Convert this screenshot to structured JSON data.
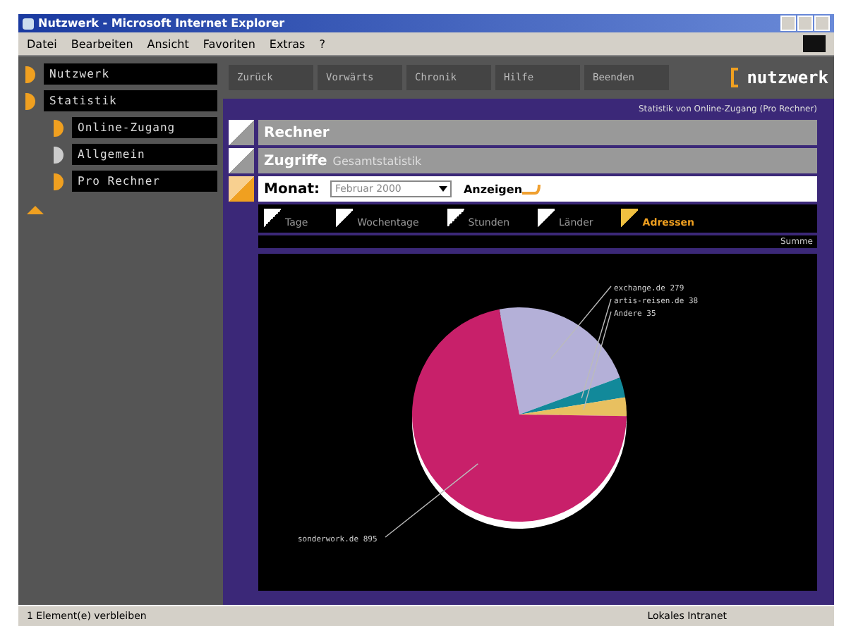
{
  "window": {
    "title": "Nutzwerk - Microsoft Internet Explorer"
  },
  "menu": [
    "Datei",
    "Bearbeiten",
    "Ansicht",
    "Favoriten",
    "Extras",
    "?"
  ],
  "sidebar": {
    "items": [
      {
        "label": "Nutzwerk",
        "selected": false
      },
      {
        "label": "Statistik",
        "selected": false,
        "children": [
          {
            "label": "Online-Zugang",
            "selected": false
          },
          {
            "label": "Allgemein",
            "selected": true
          },
          {
            "label": "Pro Rechner",
            "selected": false
          }
        ]
      }
    ]
  },
  "nav": {
    "buttons": [
      "Zurück",
      "Vorwärts",
      "Chronik",
      "Hilfe",
      "Beenden"
    ],
    "logo": "nutzwerk"
  },
  "page": {
    "subtitle": "Statistik von Online-Zugang (Pro Rechner)",
    "sections": [
      {
        "kind": "header",
        "label": "Rechner"
      },
      {
        "kind": "header",
        "label": "Zugriffe",
        "note": "Gesamtstatistik"
      },
      {
        "kind": "form",
        "label": "Monat:",
        "select": "Februar 2000",
        "button": "Anzeigen"
      }
    ],
    "tabs": [
      {
        "label": "Tage",
        "selected": false
      },
      {
        "label": "Wochentage",
        "selected": false
      },
      {
        "label": "Stunden",
        "selected": false
      },
      {
        "label": "Länder",
        "selected": false
      },
      {
        "label": "Adressen",
        "selected": true
      }
    ],
    "summary": "Summe",
    "chart": {
      "chart_data": {
        "type": "pie",
        "categories": [
          "exchange.de 279",
          "artis-reisen.de 38",
          "Andere 35",
          "sonderwork.de 895"
        ],
        "values": [
          279,
          38,
          35,
          895
        ]
      }
    }
  },
  "status_bar": {
    "text": "1 Element(e) verbleiben",
    "zone": "Lokales Intranet"
  }
}
